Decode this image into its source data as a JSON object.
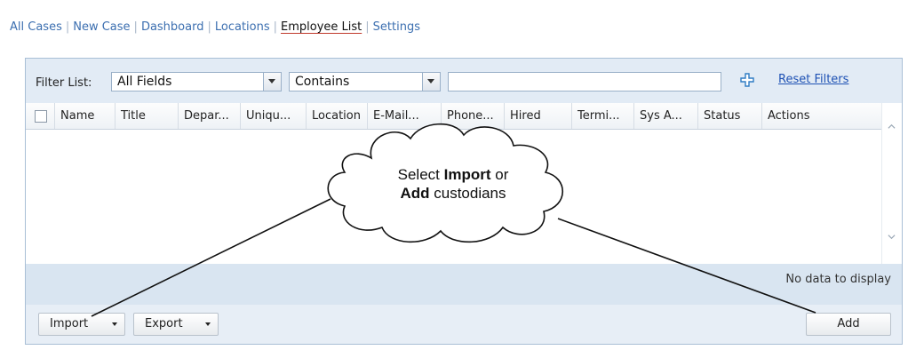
{
  "nav": {
    "items": [
      "All Cases",
      "New Case",
      "Dashboard",
      "Locations",
      "Employee List",
      "Settings"
    ],
    "active": "Employee List",
    "separator": "|"
  },
  "filter": {
    "label": "Filter List:",
    "field_value": "All Fields",
    "operator_value": "Contains",
    "text_value": "",
    "reset_label": "Reset Filters"
  },
  "grid": {
    "columns": [
      "Name",
      "Title",
      "Depar...",
      "Uniqu...",
      "Location",
      "E-Mail...",
      "Phone...",
      "Hired",
      "Termi...",
      "Sys A...",
      "Status",
      "Actions"
    ],
    "empty_text": "No data to display"
  },
  "buttons": {
    "import_label": "Import",
    "export_label": "Export",
    "add_label": "Add"
  },
  "callout": {
    "line1_prefix": "Select ",
    "line1_bold": "Import",
    "line1_suffix": " or",
    "line2_bold": "Add",
    "line2_suffix": " custodians"
  },
  "colors": {
    "link": "#3c6fb0",
    "active_underline": "#c0392b",
    "panel_header_bg": "#e2ebf5",
    "status_bg": "#d9e5f1"
  }
}
